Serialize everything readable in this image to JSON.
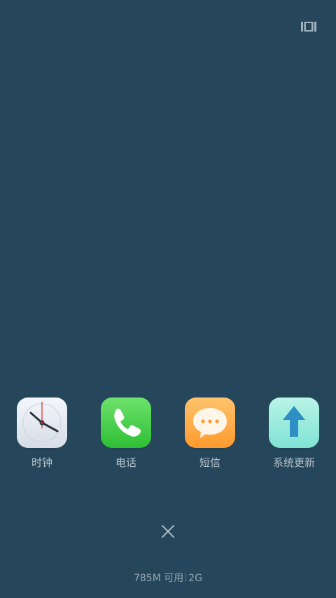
{
  "apps": [
    {
      "label": "时钟",
      "icon": "clock-icon"
    },
    {
      "label": "电话",
      "icon": "phone-icon"
    },
    {
      "label": "短信",
      "icon": "sms-icon"
    },
    {
      "label": "系统更新",
      "icon": "system-update-icon"
    }
  ],
  "memory": {
    "available": "785M 可用",
    "total": "2G"
  },
  "controls": {
    "close_icon": "close-icon",
    "view_toggle_icon": "view-toggle-icon"
  },
  "colors": {
    "background": "#26475b",
    "label": "#b6c3cc",
    "memory_text": "#95a7b3"
  }
}
